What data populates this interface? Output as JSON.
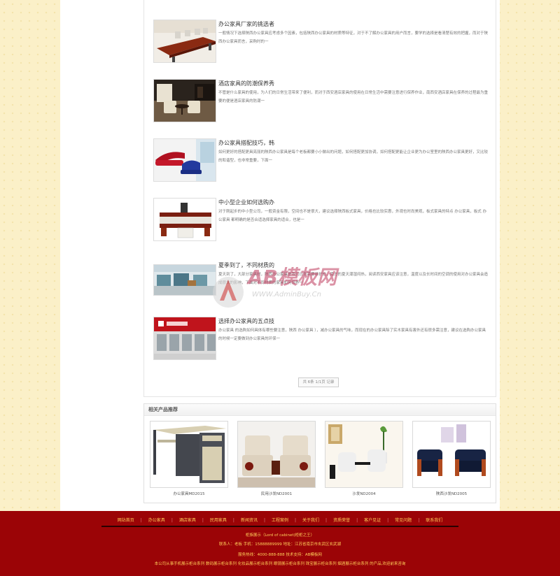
{
  "news": [
    {
      "title": "办公家具厂家的挑选者",
      "desc": "一般情况下选择陕西办公家具应考虑多个因素，包括陕西办公家具的材质等特征，对于不了解办公家具的用户而言，要学的选择是看清楚有效的把握，而对于陕西办公家具而言，采购时的一"
    },
    {
      "title": "酒店家具的防潮保养秀",
      "desc": "不管是什么家具的使用，为人们的日常生活带来了便利，而对于西安酒店家具的使用在日常生活中需要注意进行保养作业，南西安酒店家具在保养的过程最为重要的便是酒店家具的防潮一"
    },
    {
      "title": "办公家具搭配技巧，韩",
      "desc": "如何更好的搭配更具亮丽的陕西办公家具是每个老板都要小小做出的问题，如何搭配更加协调，如何搭配更能让企业更为办公室里的陕西办公家具更好，又比较的和谐型，也非常重要，下面一"
    },
    {
      "title": "中小型企业如何选购办",
      "desc": "对于刚起步的中小型公司，一般资金有限，空间也不是很大，建议选择陕西板式家具，价格也比较实惠，外观也时尚美观，板式家具的特点 办公家具，板式 办公家具 都明确的是否合适选择家具的适合，也是一"
    },
    {
      "title": "夏季到了，不同材质的",
      "desc": "夏天到了，大部分家具材，陕西办公家具是我们日常需要维护的，南方的夏天潮湿闷热，阅读西安家具应该注意，温度以及长时间的空调的使用对办公家具会造成很大的影响，下面对不同材质的家具如何保养一"
    },
    {
      "title": "选择办公家具的五点技",
      "desc": "办公家具 的选购如何具体有哪些要注意，陕西 办公家具 ），减办公家具的气味，而现在的办公家具除了实木家具有害外还有很多需注意，建议在选购办公家具的时候一定要做到办公家具的环保一"
    }
  ],
  "pager": {
    "label": "共 6条 1/1页 记录"
  },
  "related": {
    "title": "相关产品推荐",
    "products": [
      {
        "name": "办公家具MD2015",
        "icon": "computer-desk-icon"
      },
      {
        "name": "民用沙发ND2001",
        "icon": "armchair-icon"
      },
      {
        "name": "沙发ND2004",
        "icon": "sofa-set-icon"
      },
      {
        "name": "陕西沙发ND2005",
        "icon": "leather-sofa-icon"
      }
    ]
  },
  "footer": {
    "nav": [
      "网站首页",
      "办公家具",
      "酒店家具",
      "民用家具",
      "新闻资讯",
      "工程案例",
      "关于我们",
      "资质荣誉",
      "客户见证",
      "常见问题",
      "联系我们"
    ],
    "line1": "柜族展示（Lord of cabinet)柜柜之王）",
    "line2": "联系人：老板   手机：15888889999      地址：江苏省南京市玄武区玄武湖",
    "line3": "服务热线：4000-888-888 技术支持：AB模板网",
    "line4": "本公司从事手机展示柜台系列 数码展示柜台系列 化妆品展示柜台系列 眼镜展示柜台系列 珠宝展示柜台系列 烟酒展示柜台系列 的产品,欢迎前来咨询"
  },
  "watermark": {
    "brand": "AB模板网",
    "url": "WWW.AdminBuy.Cn"
  },
  "colors": {
    "background": "#fbf0c8",
    "footer": "#9b0406",
    "footer_text": "#ffcf5a"
  }
}
